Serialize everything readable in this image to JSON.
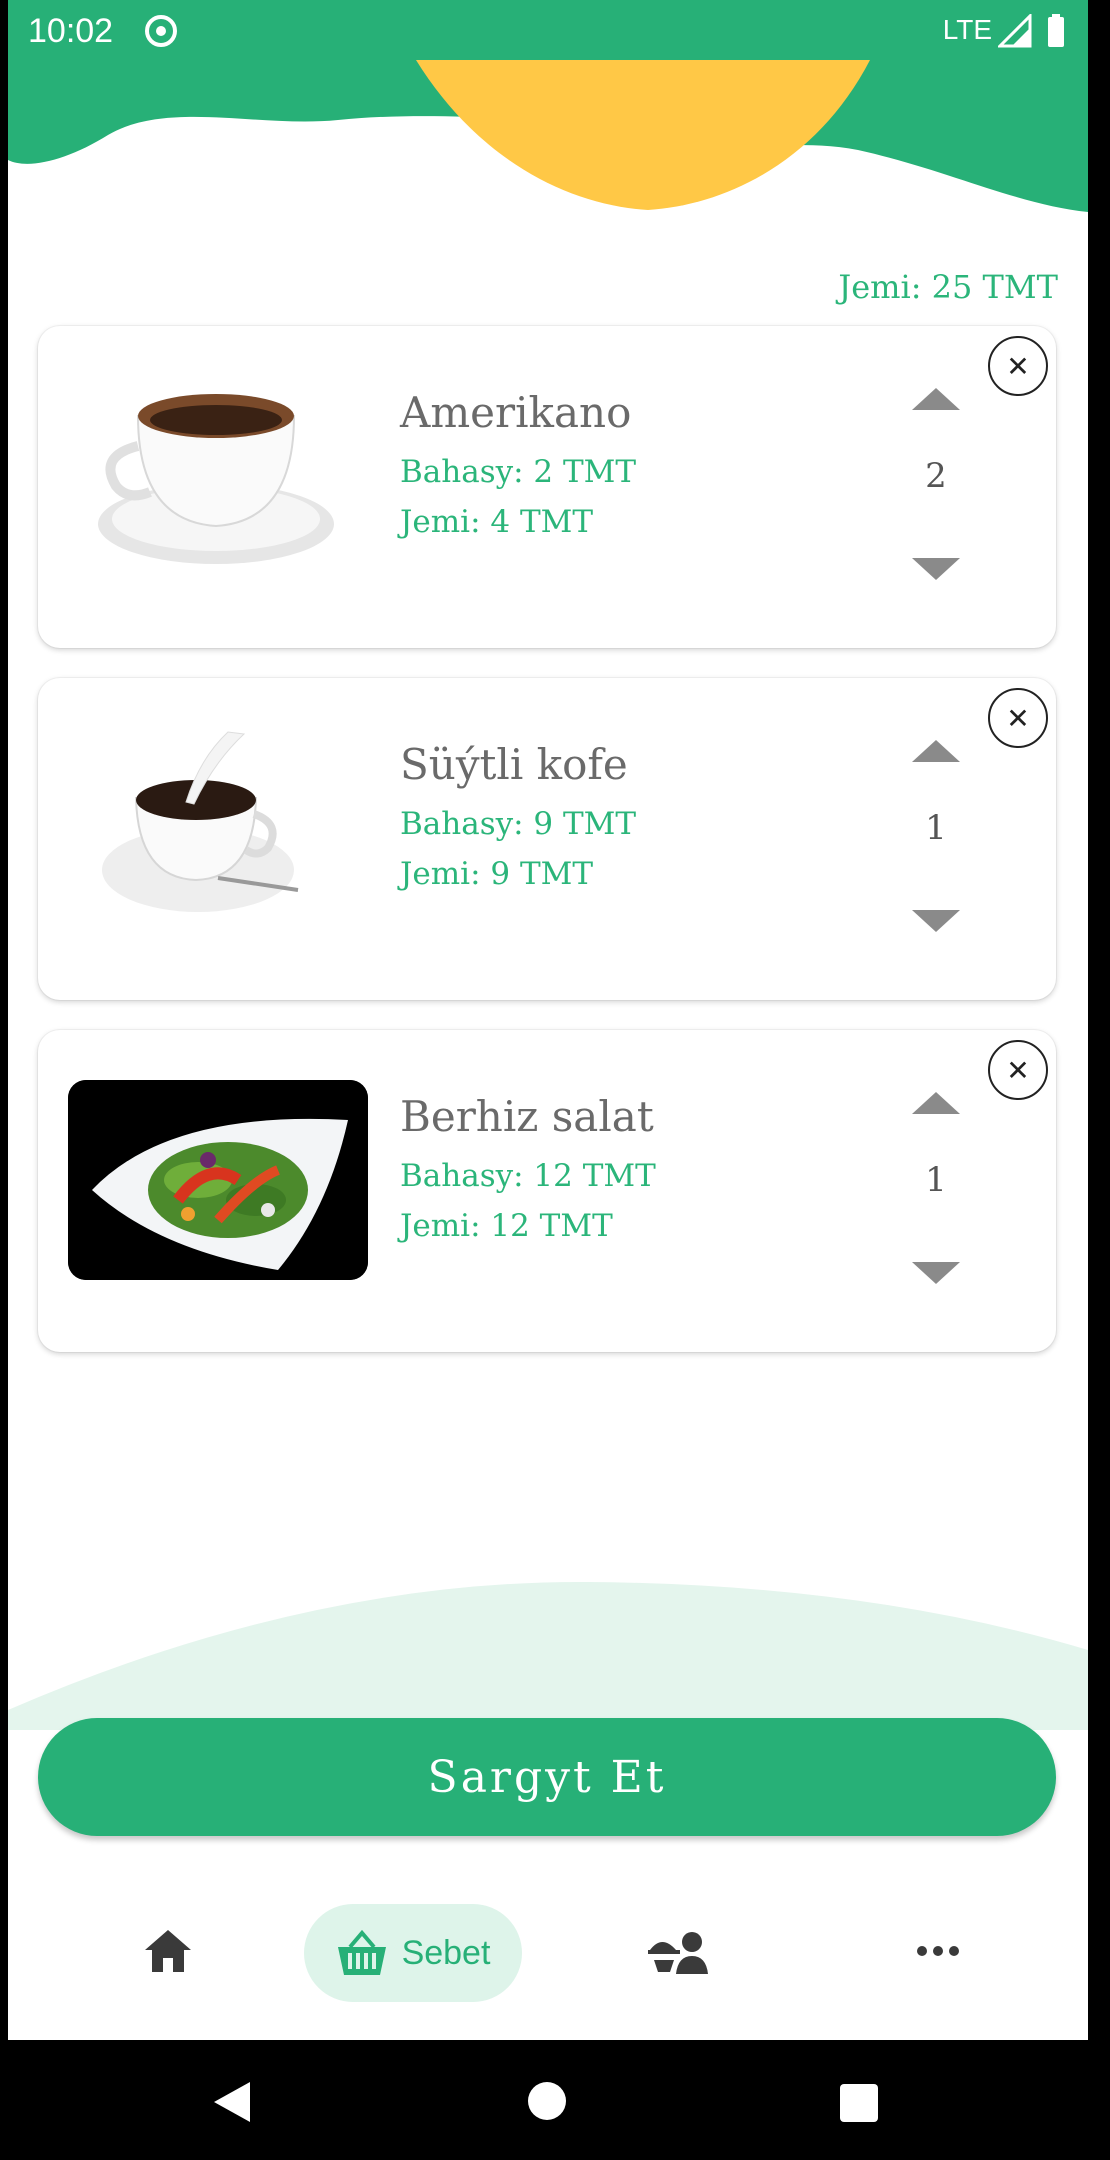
{
  "status_bar": {
    "time": "10:02",
    "network": "LTE"
  },
  "cart": {
    "grand_total": "Jemi: 25 TMT",
    "items": [
      {
        "name": "Amerikano",
        "price": "Bahasy: 2 TMT",
        "subtotal": "Jemi: 4 TMT",
        "quantity": "2",
        "image": "coffee-cup"
      },
      {
        "name": "Süýtli kofe",
        "price": "Bahasy: 9 TMT",
        "subtotal": "Jemi: 9 TMT",
        "quantity": "1",
        "image": "milk-coffee"
      },
      {
        "name": "Berhiz salat",
        "price": "Bahasy: 12 TMT",
        "subtotal": "Jemi: 12 TMT",
        "quantity": "1",
        "image": "salad-plate"
      }
    ],
    "remove_symbol": "✕"
  },
  "order_button": {
    "label": "Sargyt Et"
  },
  "bottom_nav": {
    "items": [
      {
        "icon": "home-icon"
      },
      {
        "icon": "basket-icon",
        "label": "Sebet",
        "active": true
      },
      {
        "icon": "waiter-icon"
      },
      {
        "icon": "more-icon"
      }
    ]
  },
  "colors": {
    "primary": "#27b077",
    "accent": "#ffc846",
    "text_green": "#2bb57a"
  }
}
